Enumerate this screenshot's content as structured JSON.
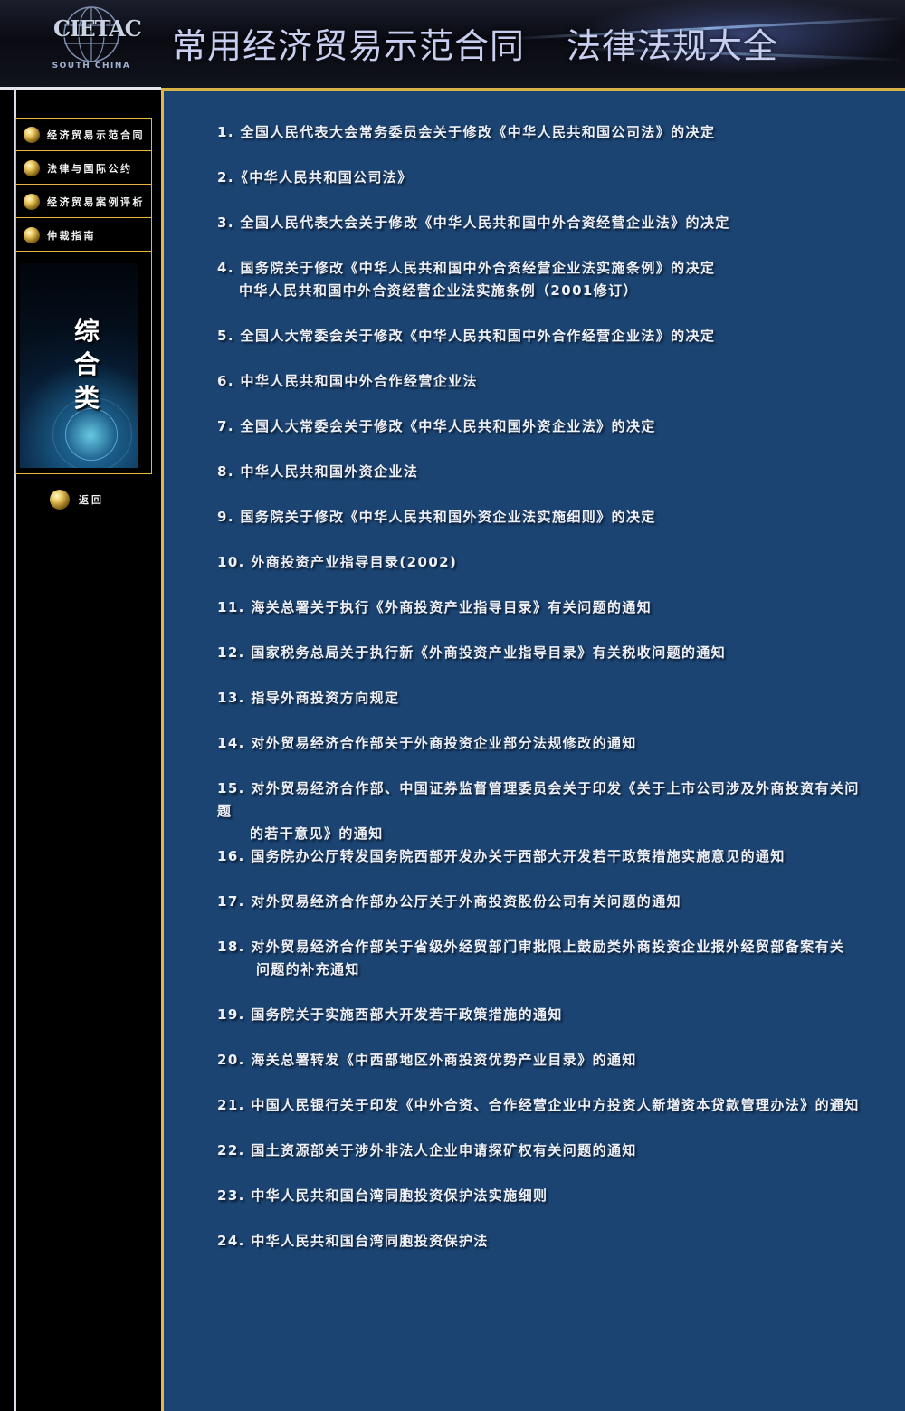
{
  "header": {
    "logo_text": "CIETAC",
    "logo_subtext": "SOUTH CHINA",
    "title_part1": "常用经济贸易示范合同",
    "title_part2": "法律法规大全"
  },
  "sidebar": {
    "menu": [
      {
        "label": "经济贸易示范合同"
      },
      {
        "label": "法律与国际公约"
      },
      {
        "label": "经济贸易案例评析"
      },
      {
        "label": "仲裁指南"
      }
    ],
    "category_title": [
      "综",
      "合",
      "类"
    ],
    "back_label": "返回"
  },
  "laws": [
    {
      "line1": "1. 全国人民代表大会常务委员会关于修改《中华人民共和国公司法》的决定"
    },
    {
      "line1": "2.《中华人民共和国公司法》"
    },
    {
      "line1": "3. 全国人民代表大会关于修改《中华人民共和国中外合资经营企业法》的决定"
    },
    {
      "line1": "4. 国务院关于修改《中华人民共和国中外合资经营企业法实施条例》的决定",
      "line2": "中华人民共和国中外合资经营企业法实施条例（2001修订）"
    },
    {
      "line1": "5. 全国人大常委会关于修改《中华人民共和国中外合作经营企业法》的决定"
    },
    {
      "line1": "6. 中华人民共和国中外合作经营企业法"
    },
    {
      "line1": "7. 全国人大常委会关于修改《中华人民共和国外资企业法》的决定"
    },
    {
      "line1": "8. 中华人民共和国外资企业法"
    },
    {
      "line1": "9. 国务院关于修改《中华人民共和国外资企业法实施细则》的决定"
    },
    {
      "line1": "10. 外商投资产业指导目录(2002)"
    },
    {
      "line1": "11. 海关总署关于执行《外商投资产业指导目录》有关问题的通知"
    },
    {
      "line1": "12. 国家税务总局关于执行新《外商投资产业指导目录》有关税收问题的通知"
    },
    {
      "line1": "13. 指导外商投资方向规定"
    },
    {
      "line1": "14. 对外贸易经济合作部关于外商投资企业部分法规修改的通知"
    },
    {
      "line1": "15. 对外贸易经济合作部、中国证券监督管理委员会关于印发《关于上市公司涉及外商投资有关问题",
      "line2": "的若干意见》的通知"
    },
    {
      "line1": "16. 国务院办公厅转发国务院西部开发办关于西部大开发若干政策措施实施意见的通知"
    },
    {
      "line1": "17. 对外贸易经济合作部办公厅关于外商投资股份公司有关问题的通知"
    },
    {
      "line1": "18. 对外贸易经济合作部关于省级外经贸部门审批限上鼓励类外商投资企业报外经贸部备案有关",
      "line2": "问题的补充通知"
    },
    {
      "line1": "19. 国务院关于实施西部大开发若干政策措施的通知"
    },
    {
      "line1": "20. 海关总署转发《中西部地区外商投资优势产业目录》的通知"
    },
    {
      "line1": "21. 中国人民银行关于印发《中外合资、合作经营企业中方投资人新增资本贷款管理办法》的通知"
    },
    {
      "line1": "22. 国土资源部关于涉外非法人企业申请探矿权有关问题的通知"
    },
    {
      "line1": "23. 中华人民共和国台湾同胞投资保护法实施细则"
    },
    {
      "line1": "24. 中华人民共和国台湾同胞投资保护法"
    }
  ]
}
